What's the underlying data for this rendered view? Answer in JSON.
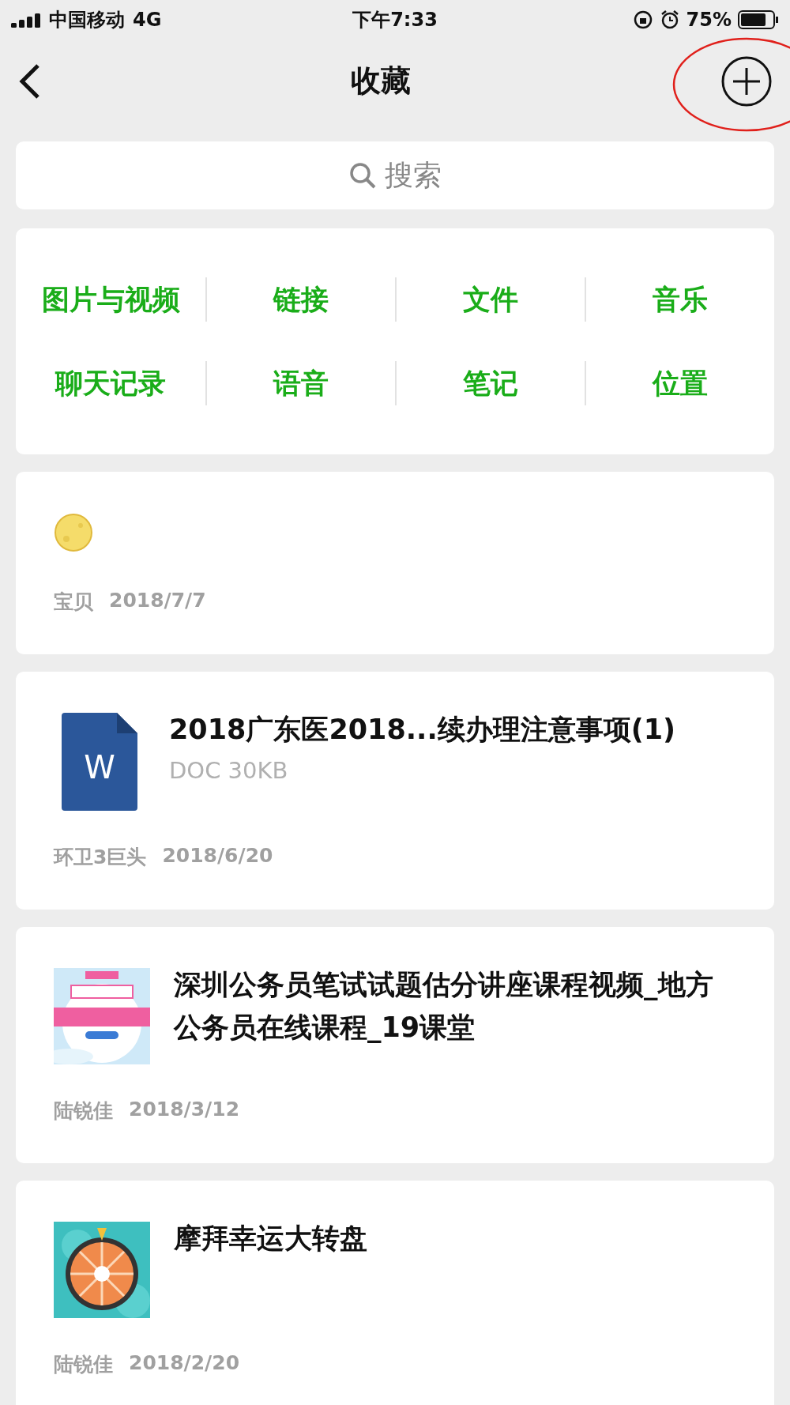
{
  "status_bar": {
    "carrier": "中国移动",
    "network": "4G",
    "time": "下午7:33",
    "battery": "75%"
  },
  "nav": {
    "title": "收藏"
  },
  "search": {
    "placeholder": "搜索"
  },
  "categories": [
    {
      "label": "图片与视频"
    },
    {
      "label": "链接"
    },
    {
      "label": "文件"
    },
    {
      "label": "音乐"
    },
    {
      "label": "聊天记录"
    },
    {
      "label": "语音"
    },
    {
      "label": "笔记"
    },
    {
      "label": "位置"
    }
  ],
  "items": [
    {
      "kind": "emoji",
      "source": "宝贝",
      "date": "2018/7/7"
    },
    {
      "kind": "file",
      "title": "2018广东医2018...续办理注意事项(1)",
      "subtitle": "DOC 30KB",
      "icon_letter": "W",
      "source": "环卫3巨头",
      "date": "2018/6/20"
    },
    {
      "kind": "link",
      "title": "深圳公务员笔试试题估分讲座课程视频_地方公务员在线课程_19课堂",
      "source": "陆锐佳",
      "date": "2018/3/12"
    },
    {
      "kind": "link",
      "title": "摩拜幸运大转盘",
      "source": "陆锐佳",
      "date": "2018/2/20"
    }
  ]
}
